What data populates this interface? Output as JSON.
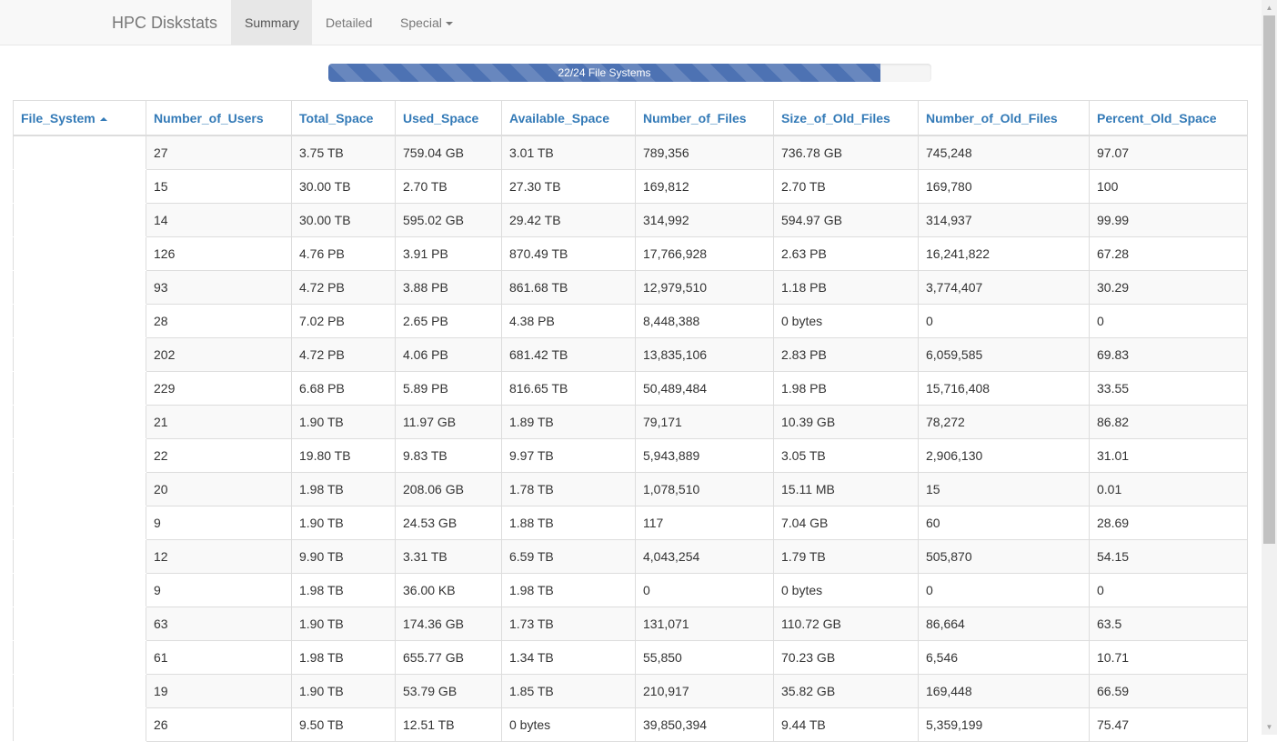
{
  "navbar": {
    "brand": "HPC Diskstats",
    "tabs": [
      {
        "label": "Summary",
        "active": true
      },
      {
        "label": "Detailed",
        "active": false
      },
      {
        "label": "Special",
        "active": false,
        "dropdown": true
      }
    ]
  },
  "progress": {
    "label": "22/24 File Systems",
    "value": 0.915
  },
  "table": {
    "columns": [
      "File_System",
      "Number_of_Users",
      "Total_Space",
      "Used_Space",
      "Available_Space",
      "Number_of_Files",
      "Size_of_Old_Files",
      "Number_of_Old_Files",
      "Percent_Old_Space"
    ],
    "sorted_column": "File_System",
    "sort_direction": "ascending",
    "rows": [
      [
        "",
        "27",
        "3.75 TB",
        "759.04 GB",
        "3.01 TB",
        "789,356",
        "736.78 GB",
        "745,248",
        "97.07"
      ],
      [
        "",
        "15",
        "30.00 TB",
        "2.70 TB",
        "27.30 TB",
        "169,812",
        "2.70 TB",
        "169,780",
        "100"
      ],
      [
        "",
        "14",
        "30.00 TB",
        "595.02 GB",
        "29.42 TB",
        "314,992",
        "594.97 GB",
        "314,937",
        "99.99"
      ],
      [
        "",
        "126",
        "4.76 PB",
        "3.91 PB",
        "870.49 TB",
        "17,766,928",
        "2.63 PB",
        "16,241,822",
        "67.28"
      ],
      [
        "",
        "93",
        "4.72 PB",
        "3.88 PB",
        "861.68 TB",
        "12,979,510",
        "1.18 PB",
        "3,774,407",
        "30.29"
      ],
      [
        "",
        "28",
        "7.02 PB",
        "2.65 PB",
        "4.38 PB",
        "8,448,388",
        "0 bytes",
        "0",
        "0"
      ],
      [
        "",
        "202",
        "4.72 PB",
        "4.06 PB",
        "681.42 TB",
        "13,835,106",
        "2.83 PB",
        "6,059,585",
        "69.83"
      ],
      [
        "",
        "229",
        "6.68 PB",
        "5.89 PB",
        "816.65 TB",
        "50,489,484",
        "1.98 PB",
        "15,716,408",
        "33.55"
      ],
      [
        "",
        "21",
        "1.90 TB",
        "11.97 GB",
        "1.89 TB",
        "79,171",
        "10.39 GB",
        "78,272",
        "86.82"
      ],
      [
        "",
        "22",
        "19.80 TB",
        "9.83 TB",
        "9.97 TB",
        "5,943,889",
        "3.05 TB",
        "2,906,130",
        "31.01"
      ],
      [
        "",
        "20",
        "1.98 TB",
        "208.06 GB",
        "1.78 TB",
        "1,078,510",
        "15.11 MB",
        "15",
        "0.01"
      ],
      [
        "",
        "9",
        "1.90 TB",
        "24.53 GB",
        "1.88 TB",
        "117",
        "7.04 GB",
        "60",
        "28.69"
      ],
      [
        "",
        "12",
        "9.90 TB",
        "3.31 TB",
        "6.59 TB",
        "4,043,254",
        "1.79 TB",
        "505,870",
        "54.15"
      ],
      [
        "",
        "9",
        "1.98 TB",
        "36.00 KB",
        "1.98 TB",
        "0",
        "0 bytes",
        "0",
        "0"
      ],
      [
        "",
        "63",
        "1.90 TB",
        "174.36 GB",
        "1.73 TB",
        "131,071",
        "110.72 GB",
        "86,664",
        "63.5"
      ],
      [
        "",
        "61",
        "1.98 TB",
        "655.77 GB",
        "1.34 TB",
        "55,850",
        "70.23 GB",
        "6,546",
        "10.71"
      ],
      [
        "",
        "19",
        "1.90 TB",
        "53.79 GB",
        "1.85 TB",
        "210,917",
        "35.82 GB",
        "169,448",
        "66.59"
      ],
      [
        "",
        "26",
        "9.50 TB",
        "12.51 TB",
        "0 bytes",
        "39,850,394",
        "9.44 TB",
        "5,359,199",
        "75.47"
      ]
    ]
  },
  "colors": {
    "link": "#337ab7",
    "progress": "#4d72b3",
    "navbar_bg": "#f8f8f8"
  }
}
